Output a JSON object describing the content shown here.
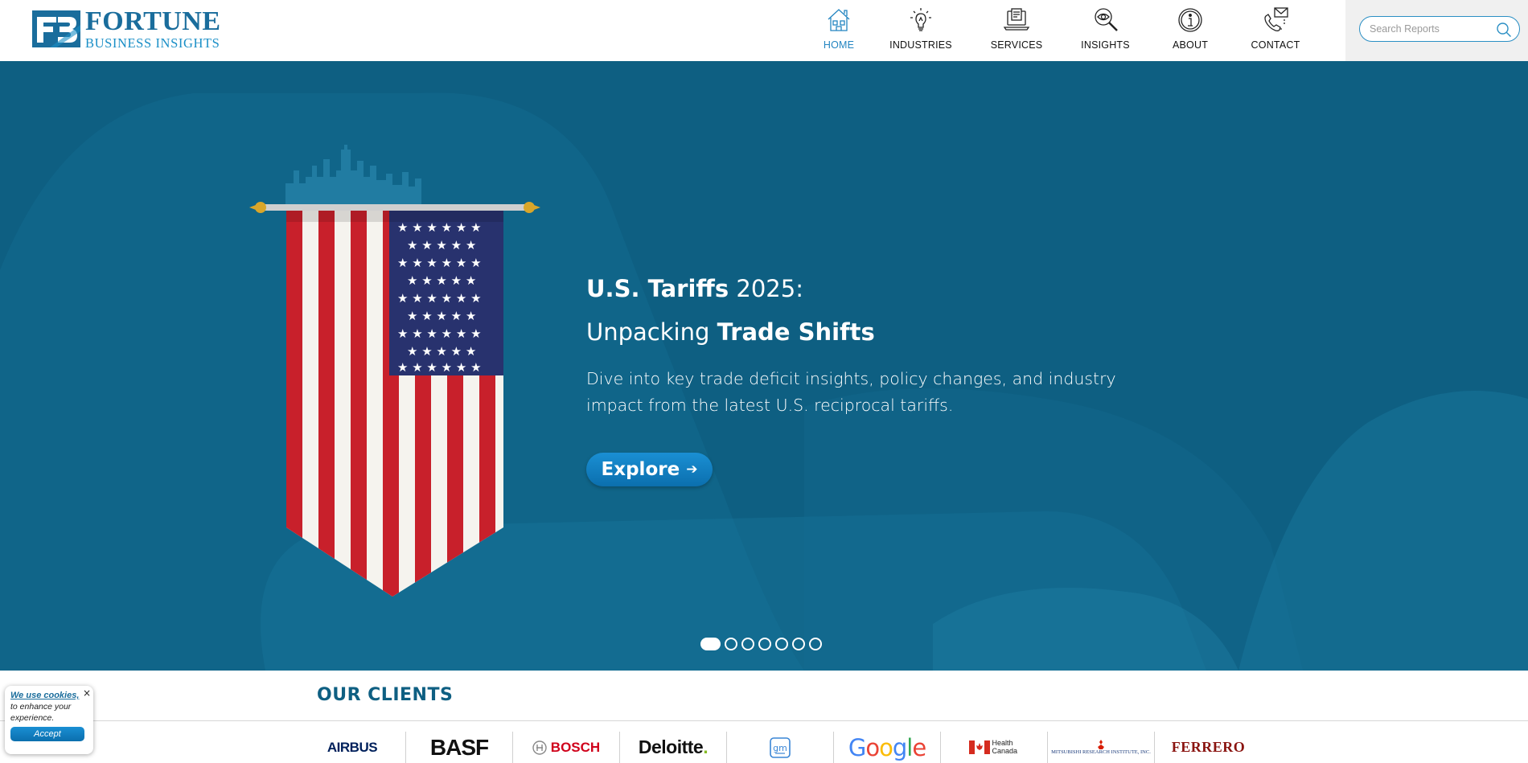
{
  "brand": {
    "name_line1": "FORTUNE",
    "name_line2": "BUSINESS INSIGHTS",
    "primary_color": "#1a6d9c",
    "accent_color": "#1a8fc7"
  },
  "nav": {
    "items": [
      {
        "label": "HOME",
        "icon": "house-icon",
        "active": true
      },
      {
        "label": "INDUSTRIES",
        "icon": "lightbulb-icon",
        "active": false
      },
      {
        "label": "SERVICES",
        "icon": "laptop-document-icon",
        "active": false
      },
      {
        "label": "INSIGHTS",
        "icon": "magnifier-eye-icon",
        "active": false
      },
      {
        "label": "ABOUT",
        "icon": "info-icon",
        "active": false
      },
      {
        "label": "CONTACT",
        "icon": "phone-mail-icon",
        "active": false
      }
    ]
  },
  "search": {
    "placeholder": "Search Reports",
    "value": "",
    "icon": "search-icon"
  },
  "hero": {
    "title_bold": "U.S. Tariffs",
    "title_rest": " 2025:",
    "subtitle_lead": "Unpacking ",
    "subtitle_bold": "Trade Shifts",
    "description": "Dive into key trade deficit insights, policy changes, and industry impact from the latest U.S. reciprocal tariffs.",
    "cta_label": "Explore",
    "cta_icon": "arrow-right-icon",
    "background_color": "#0e5f82",
    "image": "us-flag-pennant-with-skyline",
    "slides_total": 7,
    "slide_active": 1
  },
  "clients": {
    "title": "OUR CLIENTS",
    "logos": [
      {
        "name": "AIRBUS",
        "icon": "airbus-logo"
      },
      {
        "name": "BASF",
        "icon": "basf-logo"
      },
      {
        "name": "BOSCH",
        "icon": "bosch-logo"
      },
      {
        "name": "Deloitte",
        "icon": "deloitte-logo"
      },
      {
        "name": "gm",
        "icon": "gm-logo"
      },
      {
        "name": "Google",
        "icon": "google-logo"
      },
      {
        "name": "Health Canada",
        "icon": "health-canada-logo"
      },
      {
        "name": "MITSUBISHI RESEARCH INSTITUTE, INC.",
        "icon": "mitsubishi-research-logo"
      },
      {
        "name": "FERRERO",
        "icon": "ferrero-logo"
      }
    ]
  },
  "cookie": {
    "link_text": "We use cookies,",
    "body_text": "to enhance your experience.",
    "accept_label": "Accept",
    "close_label": "×"
  }
}
